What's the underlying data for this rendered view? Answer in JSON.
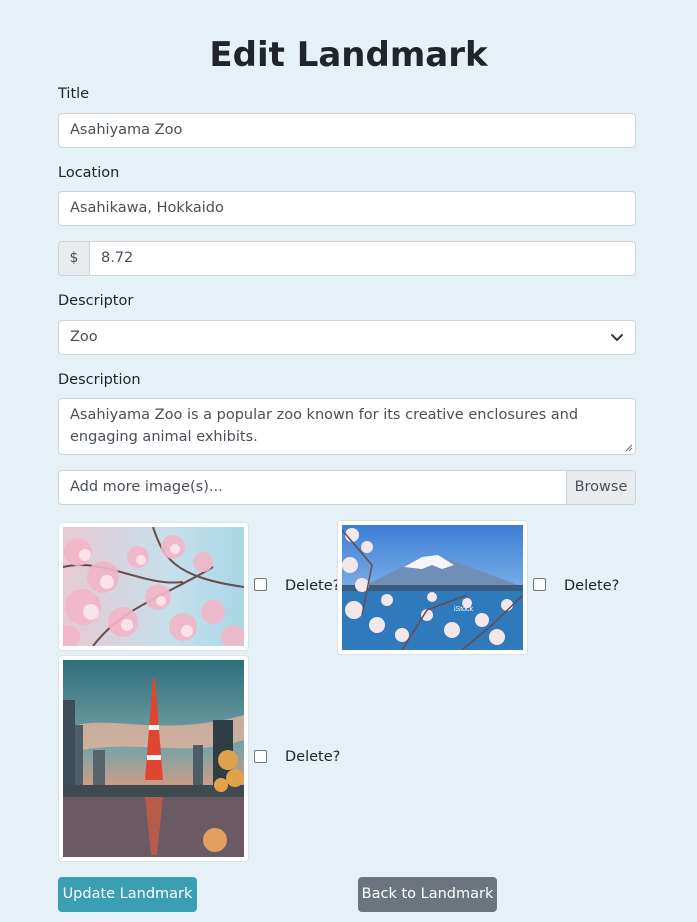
{
  "page": {
    "heading": "Edit Landmark"
  },
  "form": {
    "title_label": "Title",
    "title_value": "Asahiyama Zoo",
    "location_label": "Location",
    "location_value": "Asahikawa, Hokkaido",
    "price_addon": "$",
    "price_value": "8.72",
    "descriptor_label": "Descriptor",
    "descriptor_value": "Zoo",
    "description_label": "Description",
    "description_value": "Asahiyama Zoo is a popular zoo known for its creative enclosures and engaging animal exhibits.",
    "file_placeholder": "Add more image(s)...",
    "browse_label": "Browse"
  },
  "images": [
    {
      "subject": "cherry blossoms",
      "delete_label": "Delete?"
    },
    {
      "subject": "mount fuji with cherry blossoms",
      "delete_label": "Delete?",
      "watermark": "iStock"
    },
    {
      "subject": "tokyo tower at sunset",
      "delete_label": "Delete?"
    }
  ],
  "actions": {
    "update_label": "Update Landmark",
    "back_label": "Back to Landmark"
  },
  "colors": {
    "background": "#e5f1f6",
    "update_button": "#3a9fb3",
    "back_button": "#6c757d"
  }
}
